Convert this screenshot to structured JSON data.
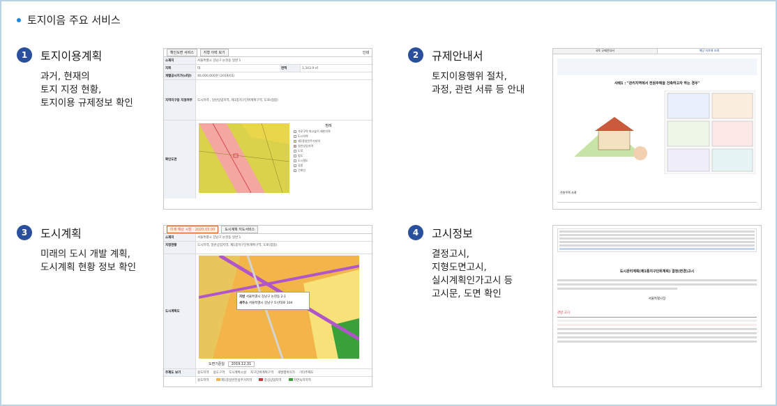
{
  "heading": "토지이음 주요 서비스",
  "services": [
    {
      "num": "1",
      "title": "토지이용계획",
      "desc": [
        "과거, 현재의",
        "토지 지정 현황,",
        "토지이용 규제정보 확인"
      ]
    },
    {
      "num": "2",
      "title": "규제안내서",
      "desc": [
        "토지이용행위 절차,",
        "과정, 관련 서류 등 안내"
      ]
    },
    {
      "num": "3",
      "title": "도시계획",
      "desc": [
        "미래의 도시 개발 계획,",
        "도시계획 현황 정보 확인"
      ]
    },
    {
      "num": "4",
      "title": "고시정보",
      "desc": [
        "결정고시,",
        "지형도면고시,",
        "실시계획인가고시 등",
        "고시문, 도면 확인"
      ]
    }
  ],
  "thumb1": {
    "tabs": [
      "확인도면 서비스",
      "지형 이력 보기"
    ],
    "print": "인쇄",
    "rows": [
      {
        "h": "소재지",
        "v": "서울특별시 강남구 논현동 일번 1"
      },
      {
        "h": "지목",
        "v": "대"
      },
      {
        "h": "개별공시지가(㎡당)",
        "v": "46,000,000원 (2019/01)"
      },
      {
        "h": "지역지구등 지정여부",
        "v": "도시지역 , 일반상업지역, 제1종지구단위계획구역, 도로(접함)"
      },
      {
        "h": "확인도면",
        "v": ""
      }
    ],
    "legend_title": "범례",
    "legend": [
      "가로구역 최고높이 제한지역",
      "도시지역",
      "제1종일반주거지역",
      "일반상업지역",
      "도로",
      "법도",
      "도시철도",
      "공원",
      "건축선"
    ],
    "area_label": "면적",
    "area_value": "1,343.9 ㎡"
  },
  "thumb2": {
    "tabs": [
      "국토 규제안내서",
      "해당 지자체 조례"
    ],
    "case_title": "사례1 : \"관리지역에서 전원주택을 건축하고자 하는 경우\"",
    "footer": "전원주택 사례"
  },
  "thumb3": {
    "badge": "미래 예상 시점 : 2020.03.00",
    "tab": "도시계획 지도서비스",
    "rows": [
      {
        "h": "소재지",
        "v": "서울특별시 강남구 논현동 일번 1"
      },
      {
        "h": "지정현황",
        "v": "도시지역, 일반상업지역, 제1종지구단위계획구역, 도로(접함)"
      },
      {
        "h": "도시계획도",
        "v": ""
      }
    ],
    "popup_label1": "지번",
    "popup_val1": "서울특별시 강남구 논현동 2-1",
    "popup_label2": "새주소",
    "popup_val2": "서울특별시 강남구 도산대로 104",
    "date_label": "도면기준일",
    "date_value": "2019.12.31",
    "bottom_label": "주제도 보기",
    "bottom_items": [
      "용도지역",
      "용도구역",
      "도시계획시설",
      "지구단위계획구역",
      "개발행위허가",
      "기타주제도"
    ],
    "legend_label": "용도지역",
    "legend_items": [
      "제1종일반전용주거지역",
      "중심상업지역",
      "자연녹지지역"
    ]
  },
  "thumb4": {
    "doc_title": "도시관리계획(제1종지구단위계획) 결정(변경)고시",
    "footer_title": "관련 고시",
    "footer_org": "서울특별시장"
  },
  "colors": {
    "accent": "#2a4f9c",
    "dot": "#1e88d8",
    "border": "#b9d3e6"
  }
}
